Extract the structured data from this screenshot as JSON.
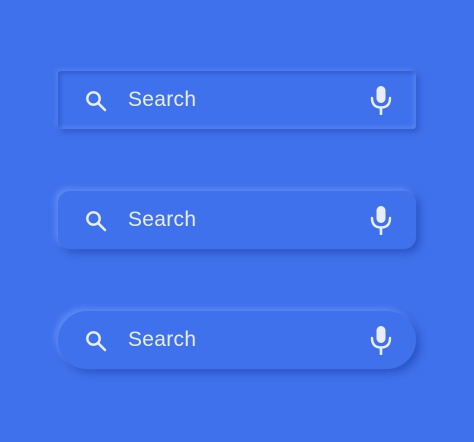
{
  "background_color": "#3f71ec",
  "text_color": "#e8eefd",
  "search_bars": [
    {
      "style": "square",
      "label": "Search",
      "left_icon": "search-icon",
      "right_icon": "microphone-icon"
    },
    {
      "style": "rounded",
      "label": "Search",
      "left_icon": "search-icon",
      "right_icon": "microphone-icon"
    },
    {
      "style": "pill",
      "label": "Search",
      "left_icon": "search-icon",
      "right_icon": "microphone-icon"
    }
  ]
}
